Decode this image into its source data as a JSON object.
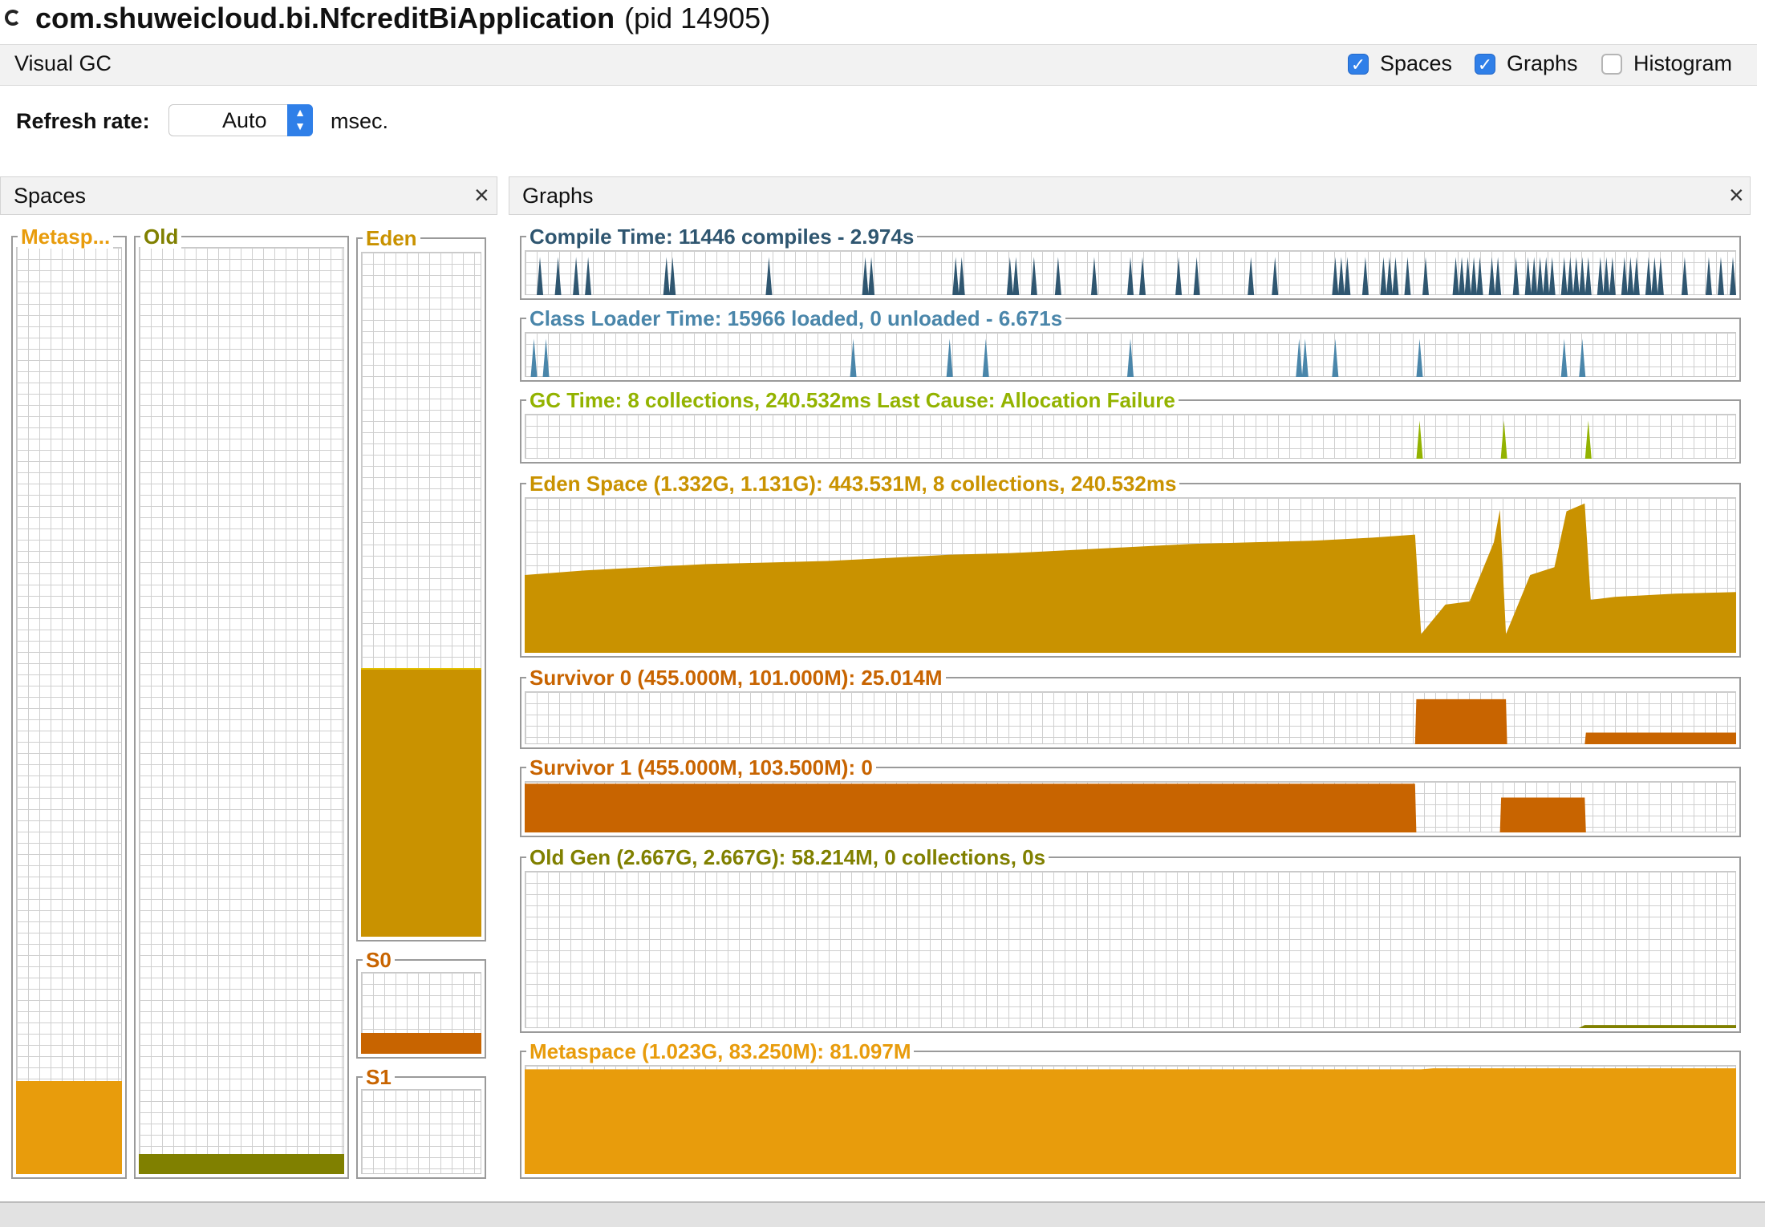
{
  "app": {
    "name": "com.shuweicloud.bi.NfcreditBiApplication",
    "pid": "(pid 14905)"
  },
  "tab": {
    "label": "Visual GC"
  },
  "options": [
    {
      "label": "Spaces",
      "checked": true
    },
    {
      "label": "Graphs",
      "checked": true
    },
    {
      "label": "Histogram",
      "checked": false
    }
  ],
  "refresh": {
    "label": "Refresh rate:",
    "value": "Auto",
    "unit": "msec."
  },
  "spaces_panel": {
    "title": "Spaces",
    "close": "×",
    "spaces": [
      {
        "label": "Metasp...",
        "color": "#e89c0c",
        "fill_fraction": 0.1
      },
      {
        "label": "Old",
        "color": "#808000",
        "fill_fraction": 0.022
      },
      {
        "label": "Eden",
        "color": "#c99200",
        "fill_fraction": 0.39
      },
      {
        "label": "S0",
        "color": "#c86400",
        "fill_fraction": 0.25
      },
      {
        "label": "S1",
        "color": "#c86400",
        "fill_fraction": 0.0
      }
    ]
  },
  "graphs_panel": {
    "title": "Graphs",
    "close": "×",
    "graphs": [
      {
        "title": "Compile Time: 11446 compiles - 2.974s",
        "color": "#2f5670"
      },
      {
        "title": "Class Loader Time: 15966 loaded, 0 unloaded - 6.671s",
        "color": "#4a86aa"
      },
      {
        "title": "GC Time: 8 collections, 240.532ms Last Cause: Allocation Failure",
        "color": "#93b300"
      },
      {
        "title": "Eden Space (1.332G, 1.131G): 443.531M, 8 collections, 240.532ms",
        "color": "#c99200"
      },
      {
        "title": "Survivor 0 (455.000M, 101.000M): 25.014M",
        "color": "#c86400"
      },
      {
        "title": "Survivor 1 (455.000M, 103.500M): 0",
        "color": "#c86400"
      },
      {
        "title": "Old Gen (2.667G, 2.667G): 58.214M, 0 collections, 0s",
        "color": "#808000"
      },
      {
        "title": "Metaspace (1.023G, 83.250M): 81.097M",
        "color": "#e89c0c"
      }
    ]
  },
  "chart_data": [
    {
      "type": "area",
      "title": "Compile Time: 11446 compiles - 2.974s",
      "spikes_x": [
        0.01,
        0.025,
        0.04,
        0.05,
        0.115,
        0.12,
        0.2,
        0.28,
        0.285,
        0.355,
        0.36,
        0.4,
        0.405,
        0.42,
        0.44,
        0.47,
        0.5,
        0.51,
        0.54,
        0.555,
        0.6,
        0.62,
        0.67,
        0.675,
        0.68,
        0.695,
        0.71,
        0.715,
        0.72,
        0.73,
        0.745,
        0.77,
        0.775,
        0.78,
        0.785,
        0.79,
        0.8,
        0.805,
        0.82,
        0.83,
        0.835,
        0.84,
        0.845,
        0.85,
        0.86,
        0.865,
        0.87,
        0.875,
        0.88,
        0.89,
        0.895,
        0.9,
        0.91,
        0.915,
        0.92,
        0.93,
        0.935,
        0.94,
        0.96,
        0.98,
        0.99,
        1.0
      ]
    },
    {
      "type": "area",
      "title": "Class Loader Time: 15966 loaded, 0 unloaded - 6.671s",
      "spikes_x": [
        0.005,
        0.015,
        0.27,
        0.35,
        0.38,
        0.5,
        0.64,
        0.645,
        0.67,
        0.74,
        0.86,
        0.875
      ]
    },
    {
      "type": "area",
      "title": "GC Time: 8 collections, 240.532ms Last Cause: Allocation Failure",
      "spikes_x": [
        0.74,
        0.81,
        0.88
      ]
    },
    {
      "type": "area",
      "title": "Eden Space (1.332G, 1.131G): 443.531M, 8 collections, 240.532ms",
      "x": [
        0,
        0.05,
        0.1,
        0.15,
        0.2,
        0.25,
        0.3,
        0.35,
        0.4,
        0.45,
        0.5,
        0.55,
        0.6,
        0.65,
        0.7,
        0.735,
        0.74,
        0.76,
        0.78,
        0.8,
        0.805,
        0.81,
        0.83,
        0.85,
        0.86,
        0.875,
        0.88,
        0.9,
        0.95,
        1.0
      ],
      "y": [
        0.5,
        0.53,
        0.55,
        0.57,
        0.58,
        0.59,
        0.61,
        0.63,
        0.64,
        0.66,
        0.68,
        0.7,
        0.71,
        0.72,
        0.74,
        0.76,
        0.12,
        0.31,
        0.33,
        0.71,
        0.92,
        0.12,
        0.5,
        0.55,
        0.91,
        0.96,
        0.34,
        0.36,
        0.38,
        0.39
      ]
    },
    {
      "type": "area",
      "title": "Survivor 0 (455.000M, 101.000M): 25.014M",
      "x": [
        0,
        0.735,
        0.736,
        0.81,
        0.811,
        0.875,
        0.876,
        1.0
      ],
      "y": [
        0,
        0,
        0.85,
        0.85,
        0,
        0,
        0.22,
        0.22
      ]
    },
    {
      "type": "area",
      "title": "Survivor 1 (455.000M, 103.500M): 0",
      "x": [
        0,
        0.735,
        0.736,
        0.805,
        0.806,
        0.875,
        0.876,
        1.0
      ],
      "y": [
        0.95,
        0.95,
        0,
        0,
        0.68,
        0.68,
        0,
        0
      ]
    },
    {
      "type": "area",
      "title": "Old Gen (2.667G, 2.667G): 58.214M, 0 collections, 0s",
      "x": [
        0,
        0.87,
        0.875,
        1.0
      ],
      "y": [
        0,
        0,
        0.02,
        0.02
      ]
    },
    {
      "type": "area",
      "title": "Metaspace (1.023G, 83.250M): 81.097M",
      "x": [
        0,
        0.74,
        0.75,
        1.0
      ],
      "y": [
        0.96,
        0.96,
        0.97,
        0.97
      ]
    }
  ]
}
